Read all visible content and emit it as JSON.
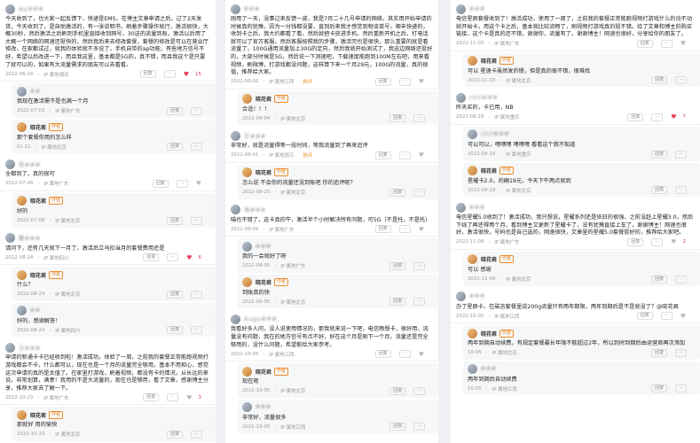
{
  "ops": {
    "reply": "回复",
    "more": "···"
  },
  "columns": [
    {
      "comments": [
        {
          "name": "wy###",
          "text": "今天收到了，也大家一起反馈下，快递是EMS，在博主文章申请之后，过了2天发货，今天收到了，是自助激活的，有一张说明书，刷着步骤操作就行，激活很快，大概30秒，然后激活之后刷到手机里直接收到网号，30送的流量到账，激活以后用了大概一个网络的网速还挺快的，然后我后来去修改套餐，套餐的修改是可以在营业厅修改，在家都试过，就我的体验就不多说了，手机自带的ap功能，有些地方信号不好，希望以后改进一下，而且我这里，基本都是5G的，真不错，而且我这个是只要了就可以的，如果有大流量需求的朋友可以去看看。",
          "date": "2022-06-29",
          "ip": "IP 属地湖北",
          "likes": "15",
          "liked": true
        },
        {
          "name": "##",
          "text": "我现在激活需不是也满一个月",
          "date": "2022-07-03",
          "ip": "IP 属地广东",
          "reply": true
        },
        {
          "name": "晓花君",
          "author": "作者",
          "text": "那个套餐你用的怎么样",
          "date": "01-11",
          "ip": "IP 属地北京",
          "reply": true
        },
        {
          "name": "流###",
          "text": "全都到了，真的很可",
          "date": "2022-07-08",
          "ip": "IP 属地广东",
          "likes": "",
          "liked": false
        },
        {
          "name": "晓花君",
          "author": "作者",
          "text": "好的",
          "date": "2022-07-08",
          "ip": "IP 属地北京",
          "reply": true
        },
        {
          "name": "路###",
          "text": "请问下，还有几天就下一月了，激活后立马扣当月的套餐费用还是",
          "date": "2022-08-24",
          "ip": "IP 属地四川",
          "likes": "6",
          "liked": true
        },
        {
          "name": "晓花君",
          "author": "作者",
          "text": "什么？",
          "date": "2022-08-24",
          "ip": "IP 属地北京",
          "reply": true
        },
        {
          "name": "##",
          "text": "好的，感谢解答！",
          "date": "2022-08-24",
          "ip": "IP 属地四川",
          "reply": true
        },
        {
          "name": "汪###",
          "text": "申请的新通卡卡已经收到啦！激活成功，体验了一周，之前我的套餐正常能跑视频打游戏都会不卡，什么都可以，现在也是一个月的流量完全够用，基本不用担心，感觉这次申请的真的是太值了。在家里打游戏，刷着视频，都没有卡的情况，从长远的来说，非常划算，满意！我用的不是大流量的，现在也是够用，看了文章，感谢博主分享，推荐大家去了解一下。",
          "date": "2022-10-23",
          "ip": "IP 属地广东",
          "likes": "3",
          "liked": false
        },
        {
          "name": "晓花君",
          "author": "作者",
          "text": "那就好 用的愉快",
          "date": "2022-10-23",
          "ip": "IP 属地北京",
          "reply": true
        }
      ]
    },
    {
      "comments": [
        {
          "name": "###",
          "text": "刚用了一天，没事过来反馈一波，我是7月二十几号申请的网络，其实用开始申请的时候真的犹豫，因为一分钱都没要，直到后来我才感觉到物流单号，顺丰快递的，收到卡之后，我大约都看了看，然后就把卡放进手机，然后重新开机之后，打电话就可以了官方客服，然后客服按照我的步骤，激活完也是很快，那么重要的就是看流量了，100G通用流量加上30G的定向，然后我就开始测试了，我这边网络还挺好的，大部分时候是5G，然后说一下测速吧，下载速度能跑到100M左右吧，用来看视频，刷微博，打游戏都没问题，这样算下来一个月29元，100G的流量，真的很值，推荐给大家。",
          "date": "2022-08-02",
          "ip": "IP 属地江西",
          "hot": "热评",
          "likes": "",
          "liked": false
        },
        {
          "name": "晓花君",
          "author": "作者",
          "text": "合适！！！",
          "date": "2022-08-04",
          "ip": "IP 属地北京",
          "reply": true
        },
        {
          "name": "王###",
          "text": "非常好，就是流量得等一段时间，等我流量到了再来追评",
          "date": "2022-08-01",
          "ip": "IP 属地浙江",
          "hot": "热评",
          "likes": "",
          "liked": false
        },
        {
          "name": "晓花君",
          "author": "作者",
          "text": "怎么说 不会你的流量还没到账吧 你的追评呢？",
          "date": "2022-08-25",
          "ip": "IP 属地北京",
          "reply": true
        },
        {
          "name": "海###",
          "text": "喵也不错了，这卡真的牛，激活半个小时解决所有问题，可5G（不是托，不是托）",
          "date": "2022-08-04",
          "ip": "IP 属地广东",
          "likes": "",
          "liked": false
        },
        {
          "name": "###",
          "text": "我的一会就好了呀",
          "date": "2022-08-05",
          "ip": "IP 属地广东",
          "reply": true
        },
        {
          "name": "晓花君",
          "author": "作者",
          "text": "到账真的快",
          "date": "2022-08-05",
          "ip": "IP 属地北京",
          "reply": true
        },
        {
          "name": "Augu###",
          "text": "我看好多人问，没人说使用情况的，那我就来说一下吧，电信畅想卡，很好用，流量没有问题，我在的地方信号有点不好，好在这个月是刚下一个月，流量还是完全够用的，没什么问题，希望能给大家参考。",
          "date": "2022-10-05",
          "ip": "IP 属地江西",
          "likes": "",
          "liked": false
        },
        {
          "name": "晓花君",
          "author": "作者",
          "text": "现在呢",
          "date": "2022-10-05",
          "ip": "IP 属地北京",
          "reply": true
        },
        {
          "name": "###",
          "text": "非常好，流量很多",
          "date": "2022-10-05",
          "ip": "IP 属地江西",
          "reply": true
        }
      ]
    },
    {
      "comments": [
        {
          "name": "###",
          "text": "电信星辰套餐收到了！激活成功，使用了一周了，之前我的套餐正常能跑视频打游戏什么的动不动就开始卡，用这个卡之后，基本就比较流畅了，刷视频打游戏真的挺不错。给了文章和博主的购买链接，这个卡是真的还不错，谢谢你，流量有了，谢谢博主！网速也很好，分享给你的朋友了。",
          "date": "2022-11-03",
          "ip": "IP 属地广东",
          "likes": "",
          "liked": false
        },
        {
          "name": "晓花君",
          "author": "作者",
          "text": "可以 星速卡虽然发的慢，但是真的很不错，很难找",
          "date": "2022-11-03",
          "ip": "IP 属地北京",
          "reply": true
        },
        {
          "name": "chil###",
          "text": "昨天买的，卡已用，NB",
          "date": "2022-08-18",
          "ip": "IP 属地重庆",
          "likes": "7",
          "liked": true
        },
        {
          "name": "chil###",
          "author": "",
          "text": "可以可以，嘿嘿嘿 嘿嘿嘿 看看这个我不知道",
          "date": "2022-08-18",
          "ip": "IP 属地重庆",
          "reply": true
        },
        {
          "name": "晓花君",
          "author": "作者",
          "text": "星耀卡2.0，的确19元，今天下午两点就到",
          "date": "2022-08-19",
          "ip": "IP 属地北京",
          "reply": true
        },
        {
          "name": "###",
          "text": "电信星耀5.0收到了！激活成功，我只想说，星耀系列还是依旧的很强，之前没赶上星耀3.0，然后下线了再还得两个月，看到博主又更新了星耀卡了，没有犹豫直接上车了，谢谢博主！网速也很好，激活很快，号码也是自己选的，网速很快，文章里的星耀5.0套餐挺好的，推荐给大家吧。",
          "date": "2022-11-09",
          "ip": "IP 属地广东",
          "likes": "2",
          "liked": false
        },
        {
          "name": "晓花君",
          "author": "作者",
          "text": "可以 感谢",
          "date": "2022-11-09",
          "ip": "IP 属地北京",
          "reply": true
        },
        {
          "name": "###",
          "text": "办了星辰卡，在磁吉套餐里说200g流量只有两年期限，两年到期后是不是就没了？@晓花君",
          "date": "2022-10-05",
          "ip": "IP 属地江西",
          "likes": "",
          "liked": false
        },
        {
          "name": "晓花君",
          "author": "作者",
          "text": "两年到期自动续费，有规定套餐最长年限不能超过2年，所以到时到期后由运营商再次添加",
          "date": "10-05",
          "ip": "IP 属地北京",
          "reply": true
        },
        {
          "name": "###",
          "text": "两年到期后自动续费",
          "date": "10-05",
          "ip": "IP 属地江西",
          "reply": true
        }
      ]
    }
  ]
}
